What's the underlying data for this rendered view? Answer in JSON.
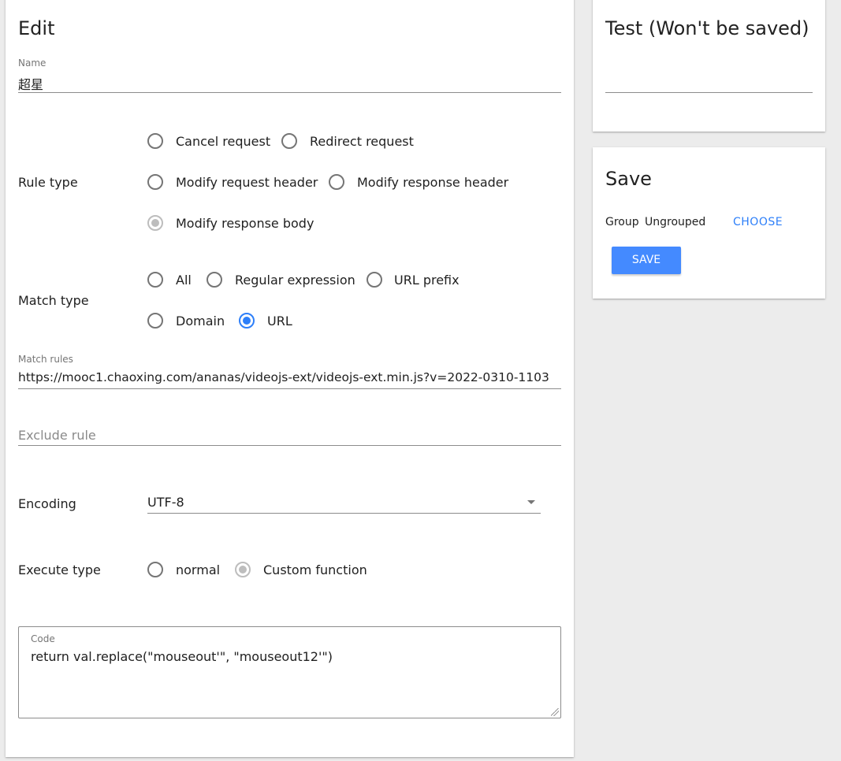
{
  "edit": {
    "title": "Edit",
    "name_label": "Name",
    "name_value": "超星",
    "rule_type_label": "Rule type",
    "rule_types": [
      {
        "label": "Cancel request",
        "state": "unchecked"
      },
      {
        "label": "Redirect request",
        "state": "unchecked"
      },
      {
        "label": "Modify request header",
        "state": "unchecked"
      },
      {
        "label": "Modify response header",
        "state": "unchecked"
      },
      {
        "label": "Modify response body",
        "state": "checked-disabled"
      }
    ],
    "match_type_label": "Match type",
    "match_types": [
      {
        "label": "All",
        "state": "unchecked"
      },
      {
        "label": "Regular expression",
        "state": "unchecked"
      },
      {
        "label": "URL prefix",
        "state": "unchecked"
      },
      {
        "label": "Domain",
        "state": "unchecked"
      },
      {
        "label": "URL",
        "state": "checked"
      }
    ],
    "match_rules_label": "Match rules",
    "match_rules_value": "https://mooc1.chaoxing.com/ananas/videojs-ext/videojs-ext.min.js?v=2022-0310-1103",
    "exclude_placeholder": "Exclude rule",
    "encoding_label": "Encoding",
    "encoding_value": "UTF-8",
    "execute_type_label": "Execute type",
    "execute_types": [
      {
        "label": "normal",
        "state": "unchecked"
      },
      {
        "label": "Custom function",
        "state": "checked-disabled"
      }
    ],
    "code_label": "Code",
    "code_value": "return val.replace(\"mouseout'\", \"mouseout12'\")"
  },
  "test": {
    "title": "Test (Won't be saved)",
    "input_value": ""
  },
  "save": {
    "title": "Save",
    "group_label": "Group",
    "group_value": "Ungrouped",
    "choose_label": "CHOOSE",
    "save_label": "SAVE"
  },
  "colors": {
    "accent": "#2d7ff9",
    "save_button": "#448aff",
    "background": "#ececec"
  }
}
